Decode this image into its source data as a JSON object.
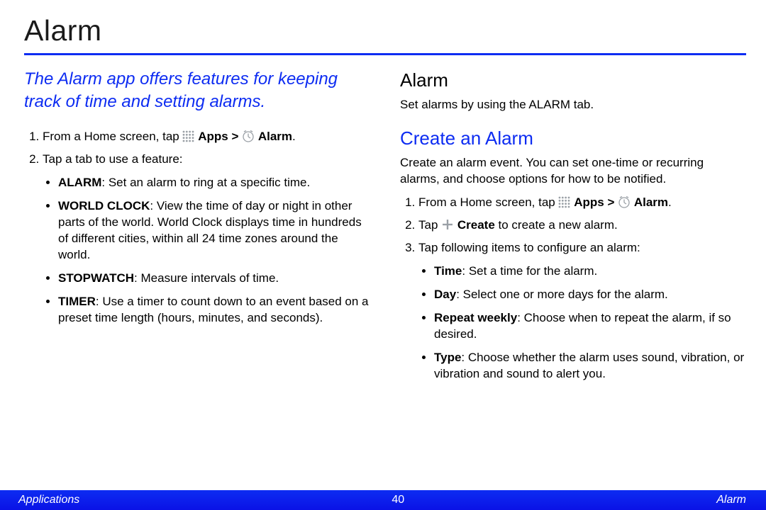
{
  "title": "Alarm",
  "intro": "The Alarm app offers features for keeping track of time and setting alarms.",
  "left": {
    "step1_pre": "From a Home screen, tap ",
    "apps_label": "Apps",
    "gt": " > ",
    "alarm_label": "Alarm",
    "period": ".",
    "step2": "Tap a tab to use a feature:",
    "sub": {
      "alarm": {
        "b": "ALARM",
        "t": ": Set an alarm to ring at a specific time."
      },
      "world": {
        "b": "WORLD CLOCK",
        "t": ": View the time of day or night in other parts of the world. World Clock displays time in hundreds of different cities, within all 24 time zones around the world."
      },
      "stop": {
        "b": "STOPWATCH",
        "t": ": Measure intervals of time."
      },
      "timer": {
        "b": "TIMER",
        "t": ": Use a timer to count down to an event based on a preset time length (hours, minutes, and seconds)."
      }
    }
  },
  "right": {
    "h_alarm": "Alarm",
    "p_alarm": "Set alarms by using the ALARM tab.",
    "h_create": "Create an Alarm",
    "p_create": "Create an alarm event. You can set one-time or recurring alarms, and choose options for how to be notified.",
    "step1_pre": "From a Home screen, tap ",
    "apps_label": "Apps",
    "gt": " > ",
    "alarm_label": "Alarm",
    "period": ".",
    "step2_pre": "Tap ",
    "create_label": "Create",
    "step2_post": " to create a new alarm.",
    "step3": "Tap following items to configure an alarm:",
    "sub": {
      "time": {
        "b": "Time",
        "t": ": Set a time for the alarm."
      },
      "day": {
        "b": "Day",
        "t": ": Select one or more days for the alarm."
      },
      "repeat": {
        "b": "Repeat weekly",
        "t": ": Choose when to repeat the alarm, if so desired."
      },
      "type": {
        "b": "Type",
        "t": ": Choose whether the alarm uses sound, vibration, or vibration and sound to alert you."
      }
    }
  },
  "footer": {
    "left": "Applications",
    "center": "40",
    "right": "Alarm"
  }
}
